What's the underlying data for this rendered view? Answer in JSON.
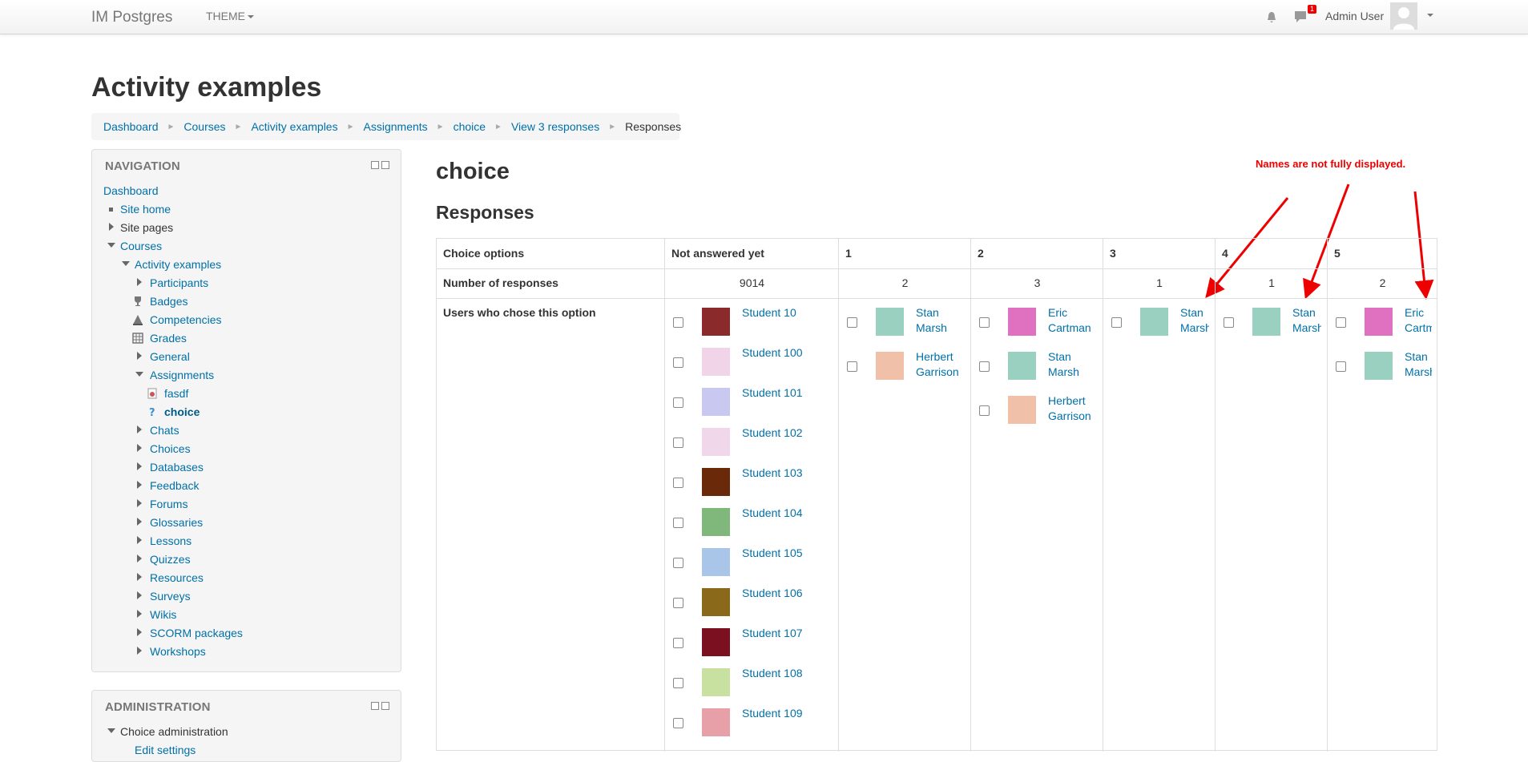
{
  "navbar": {
    "brand": "IM Postgres",
    "theme_menu": "THEME",
    "notifications_icon": "bell-icon",
    "messages_icon": "message-icon",
    "messages_badge": "1",
    "user_name": "Admin User"
  },
  "header": {
    "title": "Activity examples",
    "breadcrumb": [
      "Dashboard",
      "Courses",
      "Activity examples",
      "Assignments",
      "choice",
      "View 3 responses",
      "Responses"
    ]
  },
  "navigation": {
    "title": "NAVIGATION",
    "items": [
      {
        "label": "Dashboard"
      },
      {
        "label": "Site home"
      },
      {
        "label": "Site pages"
      },
      {
        "label": "Courses"
      },
      {
        "label": "Activity examples"
      },
      {
        "label": "Participants"
      },
      {
        "label": "Badges"
      },
      {
        "label": "Competencies"
      },
      {
        "label": "Grades"
      },
      {
        "label": "General"
      },
      {
        "label": "Assignments"
      },
      {
        "label": "fasdf"
      },
      {
        "label": "choice"
      },
      {
        "label": "Chats"
      },
      {
        "label": "Choices"
      },
      {
        "label": "Databases"
      },
      {
        "label": "Feedback"
      },
      {
        "label": "Forums"
      },
      {
        "label": "Glossaries"
      },
      {
        "label": "Lessons"
      },
      {
        "label": "Quizzes"
      },
      {
        "label": "Resources"
      },
      {
        "label": "Surveys"
      },
      {
        "label": "Wikis"
      },
      {
        "label": "SCORM packages"
      },
      {
        "label": "Workshops"
      }
    ]
  },
  "administration": {
    "title": "ADMINISTRATION",
    "items": [
      {
        "label": "Choice administration"
      },
      {
        "label": "Edit settings"
      }
    ]
  },
  "main": {
    "activity_title": "choice",
    "section_title": "Responses",
    "annotation": "Names are not fully displayed.",
    "table": {
      "row_labels": [
        "Choice options",
        "Number of responses",
        "Users who chose this option"
      ],
      "columns": [
        {
          "header": "Not answered yet",
          "count": "9014",
          "users": [
            "Student 10",
            "Student 100",
            "Student 101",
            "Student 102",
            "Student 103",
            "Student 104",
            "Student 105",
            "Student 106",
            "Student 107",
            "Student 108",
            "Student 109"
          ]
        },
        {
          "header": "1",
          "count": "2",
          "users": [
            "Stan Marsh",
            "Herbert Garrison"
          ]
        },
        {
          "header": "2",
          "count": "3",
          "users": [
            "Eric Cartman",
            "Stan Marsh",
            "Herbert Garrison"
          ]
        },
        {
          "header": "3",
          "count": "1",
          "users": [
            "Stan Marsh"
          ]
        },
        {
          "header": "4",
          "count": "1",
          "users": [
            "Stan Marsh"
          ]
        },
        {
          "header": "5",
          "count": "2",
          "users": [
            "Eric Cartman",
            "Stan Marsh"
          ]
        }
      ]
    }
  },
  "colors": {
    "link": "#0070a8",
    "annotation": "#ee0000"
  }
}
